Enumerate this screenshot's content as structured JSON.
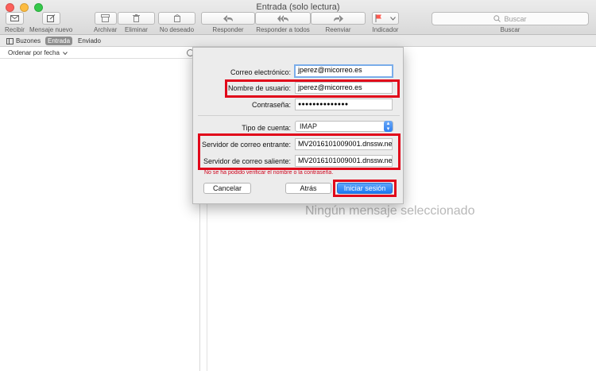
{
  "window": {
    "title": "Entrada (solo lectura)",
    "traffic_lights": [
      "#fc605b",
      "#fdbc40",
      "#34c84a"
    ]
  },
  "toolbar": {
    "buttons": [
      {
        "label": "Recibir",
        "icon": "envelope-icon"
      },
      {
        "label": "Mensaje nuevo",
        "icon": "compose-icon"
      },
      {
        "label": "Archivar",
        "icon": "archive-icon"
      },
      {
        "label": "Eliminar",
        "icon": "trash-icon"
      },
      {
        "label": "No deseado",
        "icon": "junk-icon"
      },
      {
        "label": "Responder",
        "icon": "reply-icon"
      },
      {
        "label": "Responder a todos",
        "icon": "reply-all-icon"
      },
      {
        "label": "Reenviar",
        "icon": "forward-icon"
      },
      {
        "label": "Indicador",
        "icon": "flag-icon"
      }
    ],
    "search": {
      "placeholder": "Buscar",
      "label": "Buscar"
    }
  },
  "favorites": {
    "items": [
      {
        "label": "Buzones",
        "selected": false
      },
      {
        "label": "Entrada",
        "selected": true
      },
      {
        "label": "Enviado",
        "selected": false
      }
    ]
  },
  "message_list": {
    "sort_label": "Ordenar por fecha"
  },
  "viewer": {
    "empty_text": "Ningún mensaje seleccionado"
  },
  "dialog": {
    "email": {
      "label": "Correo electrónico:",
      "value": "jperez@micorreo.es"
    },
    "username": {
      "label": "Nombre de usuario:",
      "value": "jperez@micorreo.es"
    },
    "password": {
      "label": "Contraseña:",
      "value": "●●●●●●●●●●●●●●"
    },
    "account_type": {
      "label": "Tipo de cuenta:",
      "value": "IMAP"
    },
    "incoming_server": {
      "label": "Servidor de correo entrante:",
      "value": "MV2016101009001.dnssw.net"
    },
    "outgoing_server": {
      "label": "Servidor de correo saliente:",
      "value": "MV2016101009001.dnssw.net"
    },
    "error": "No se ha podido verificar el nombre o la contraseña.",
    "cancel": "Cancelar",
    "back": "Atrás",
    "sign_in": "Iniciar sesión"
  },
  "colors": {
    "highlight": "#e1061a",
    "accent": "#1b78f2",
    "error": "#d0021b"
  }
}
